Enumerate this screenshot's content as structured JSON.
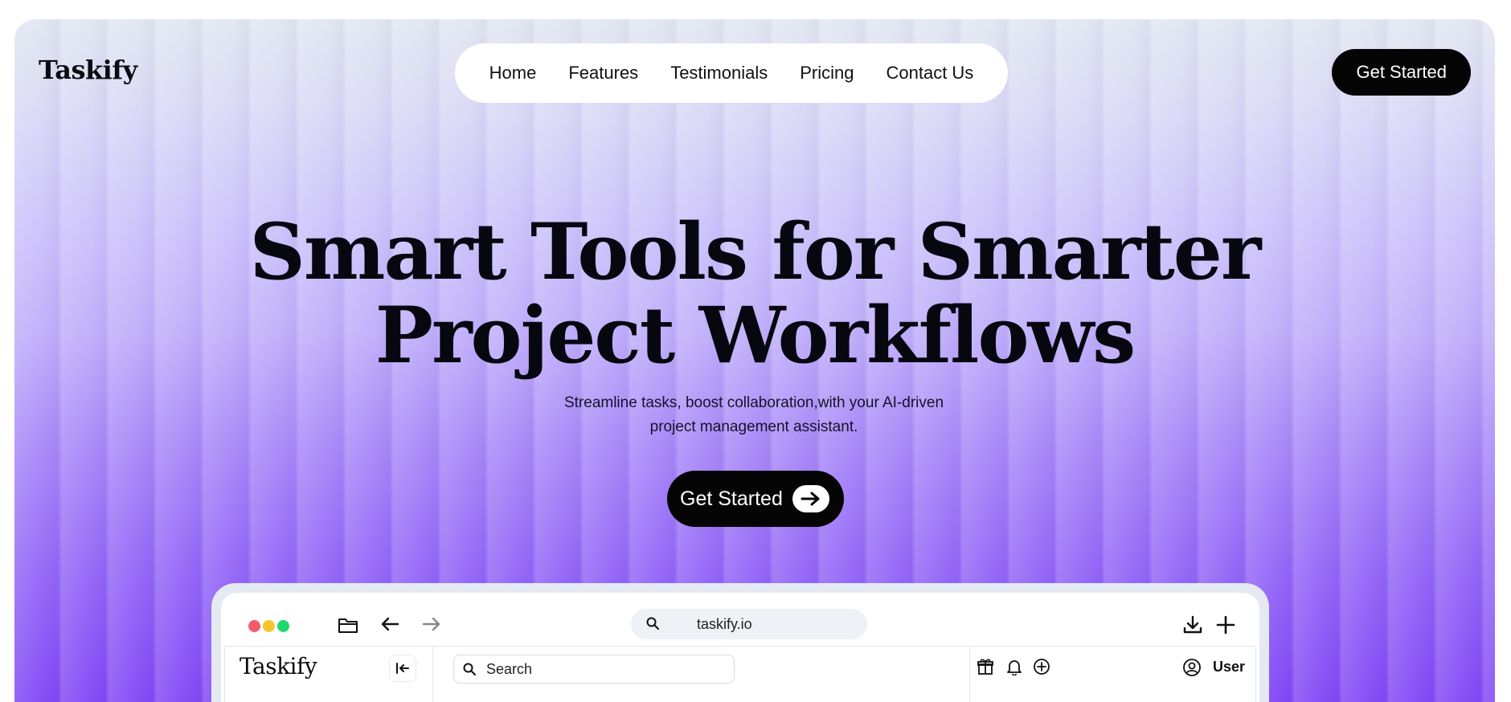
{
  "brand": {
    "name": "Taskify"
  },
  "nav": {
    "items": [
      {
        "label": "Home"
      },
      {
        "label": "Features"
      },
      {
        "label": "Testimonials"
      },
      {
        "label": "Pricing"
      },
      {
        "label": "Contact Us"
      }
    ]
  },
  "header": {
    "cta_label": "Get Started"
  },
  "hero": {
    "headline_line1": "Smart Tools for Smarter",
    "headline_line2": "Project Workflows",
    "subline_line1": "Streamline tasks, boost collaboration,with your AI-driven",
    "subline_line2": "project management assistant.",
    "cta_label": "Get Started",
    "cta_icon": "arrow-right-icon"
  },
  "colors": {
    "gradient_top": "#e2e7f1",
    "gradient_bottom": "#8248f5",
    "button_bg": "#050505",
    "dot_red": "#f45b69",
    "dot_yellow": "#f7c52a",
    "dot_green": "#1fd76f"
  },
  "preview": {
    "browser": {
      "url": "taskify.io",
      "left_icons": [
        "folder-icon",
        "arrow-left-icon",
        "arrow-right-icon"
      ],
      "right_icons": [
        "download-icon",
        "plus-icon"
      ]
    },
    "app": {
      "logo": "Taskify",
      "search_placeholder": "Search",
      "toolbar_icons": [
        "gift-icon",
        "bell-icon",
        "add-circle-icon"
      ],
      "user_label": "User"
    }
  }
}
